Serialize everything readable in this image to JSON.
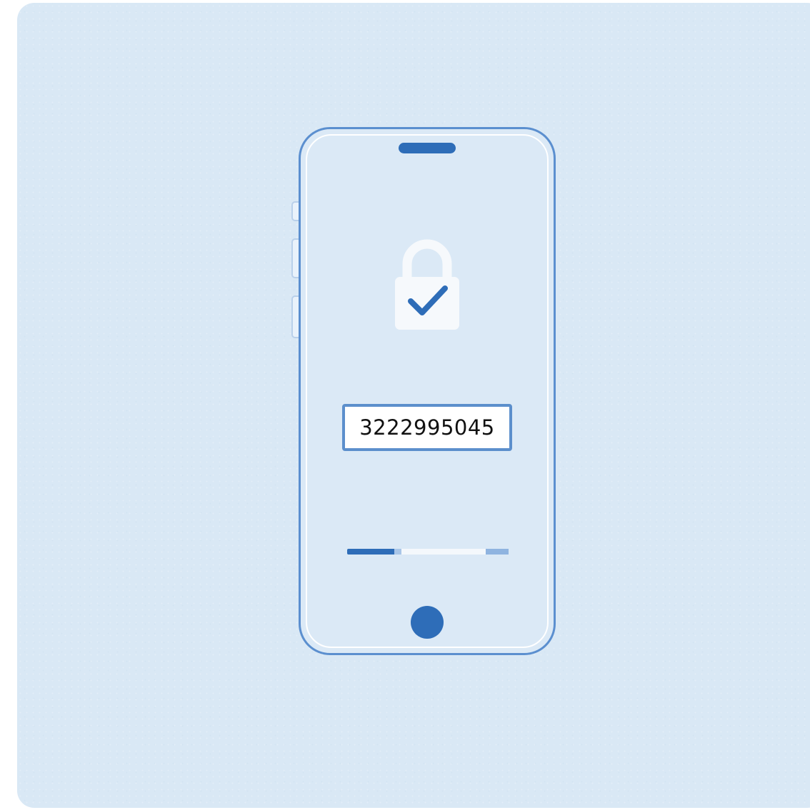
{
  "verification": {
    "code": "3222995045",
    "lock_icon": "padlock-check-icon",
    "progress_fraction": 0.29
  },
  "colors": {
    "background": "#d9e8f5",
    "accent": "#2e6db8",
    "phone_outline": "#5b8fcf",
    "lock_body": "#f6f9fc"
  }
}
